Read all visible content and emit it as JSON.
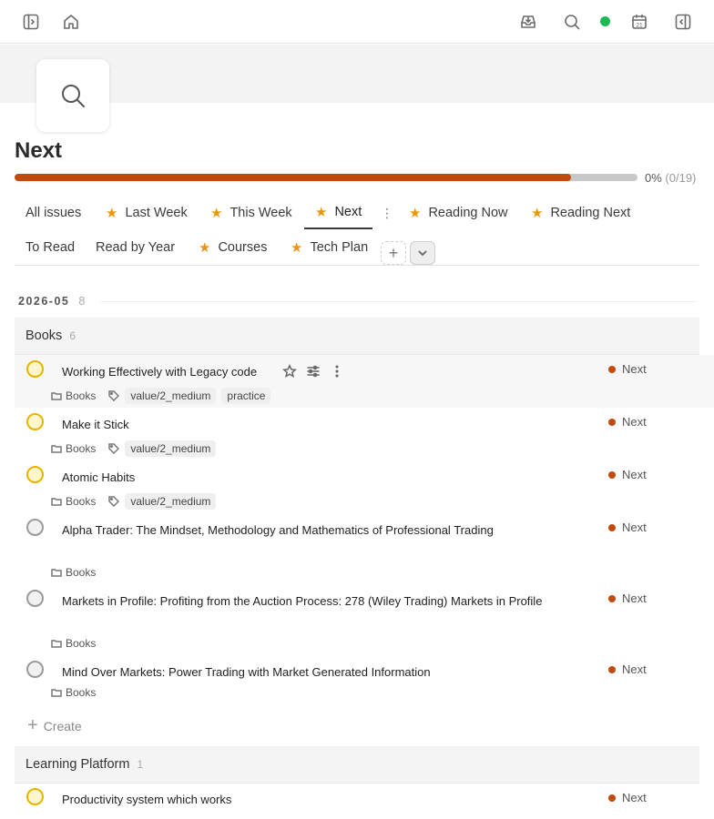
{
  "topbar": {
    "icons": [
      "sidebar-toggle-icon",
      "home-icon",
      "inbox-icon",
      "search-icon",
      "status-dot",
      "calendar-icon",
      "right-panel-icon"
    ],
    "calendar_day": "21",
    "status_color": "#1db954"
  },
  "page": {
    "icon": "search-icon",
    "title": "Next"
  },
  "progress": {
    "percent_label": "0%",
    "count_label": "(0/19)",
    "fill_fraction": 0.894,
    "fill_color": "#c24a0c"
  },
  "tabs": [
    {
      "label": "All issues",
      "starred": false,
      "active": false
    },
    {
      "label": "Last Week",
      "starred": true,
      "active": false
    },
    {
      "label": "This Week",
      "starred": true,
      "active": false
    },
    {
      "label": "Next",
      "starred": true,
      "active": true
    },
    {
      "label": "Reading Now",
      "starred": true,
      "active": false
    },
    {
      "label": "Reading Next",
      "starred": true,
      "active": false
    },
    {
      "label": "To Read",
      "starred": false,
      "active": false
    },
    {
      "label": "Read by Year",
      "starred": false,
      "active": false
    },
    {
      "label": "Courses",
      "starred": true,
      "active": false
    },
    {
      "label": "Tech Plan",
      "starred": true,
      "active": false
    }
  ],
  "date_group": {
    "label": "2026-05",
    "count": "8"
  },
  "groups": [
    {
      "label": "Books",
      "count": "6"
    },
    {
      "label": "Learning Platform",
      "count": "1"
    }
  ],
  "status_color": "#c24a0c",
  "items": [
    {
      "title": "Working Effectively with Legacy code",
      "project": "Books",
      "tags": [
        "value/2_medium",
        "practice"
      ],
      "status": "Next",
      "state": "yellow"
    },
    {
      "title": "Make it Stick",
      "project": "Books",
      "tags": [
        "value/2_medium"
      ],
      "status": "Next",
      "state": "yellow"
    },
    {
      "title": "Atomic Habits",
      "project": "Books",
      "tags": [
        "value/2_medium"
      ],
      "status": "Next",
      "state": "yellow"
    },
    {
      "title": "Alpha Trader: The Mindset, Methodology and Mathematics of Professional Trading",
      "project": "Books",
      "tags": [],
      "status": "Next",
      "state": "grey"
    },
    {
      "title": "Markets in Profile: Profiting from the Auction Process: 278 (Wiley Trading) Markets in Profile",
      "project": "Books",
      "tags": [],
      "status": "Next",
      "state": "grey"
    },
    {
      "title": "Mind Over Markets: Power Trading with Market Generated Information",
      "project": "Books",
      "tags": [],
      "status": "Next",
      "state": "grey"
    },
    {
      "title": "Productivity system which works",
      "project": "",
      "tags": [],
      "status": "Next",
      "state": "yellow"
    }
  ],
  "create_label": "Create"
}
